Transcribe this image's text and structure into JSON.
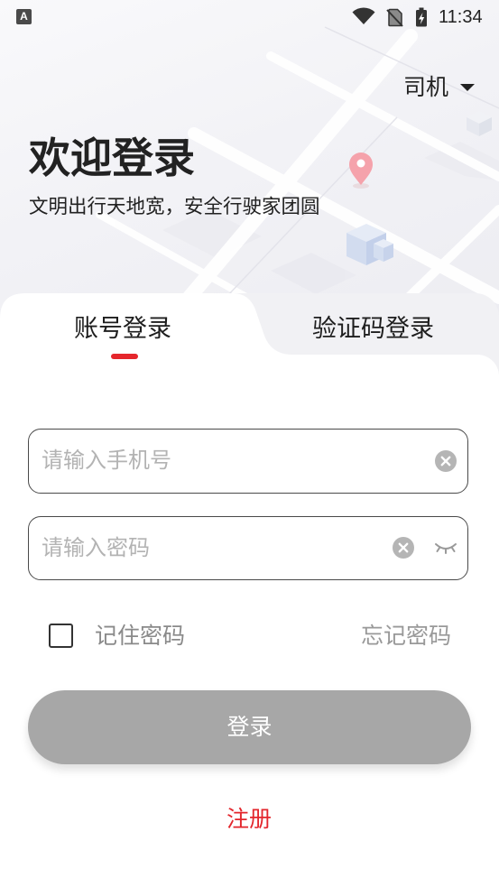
{
  "status_bar": {
    "notification_glyph": "A",
    "time": "11:34",
    "icons": [
      "wifi-icon",
      "no-sim-icon",
      "battery-charging-icon"
    ]
  },
  "role_selector": {
    "label": "司机",
    "icon": "dropdown-triangle-icon"
  },
  "header": {
    "title": "欢迎登录",
    "subtitle": "文明出行天地宽，安全行驶家团圆"
  },
  "tabs": [
    {
      "label": "账号登录",
      "active": true
    },
    {
      "label": "验证码登录",
      "active": false
    }
  ],
  "form": {
    "phone": {
      "value": "",
      "placeholder": "请输入手机号",
      "clear_icon": "clear-icon"
    },
    "password": {
      "value": "",
      "placeholder": "请输入密码",
      "clear_icon": "clear-icon",
      "visibility_icon": "eye-closed-icon"
    },
    "remember_password": {
      "label": "记住密码",
      "checked": false
    },
    "forgot_password": "忘记密码",
    "login_button": "登录",
    "register_link": "注册"
  },
  "colors": {
    "accent": "#e5262c",
    "login_button": "#a7a7a7",
    "input_border": "#4a4a4a",
    "placeholder": "#b3b3b3"
  }
}
